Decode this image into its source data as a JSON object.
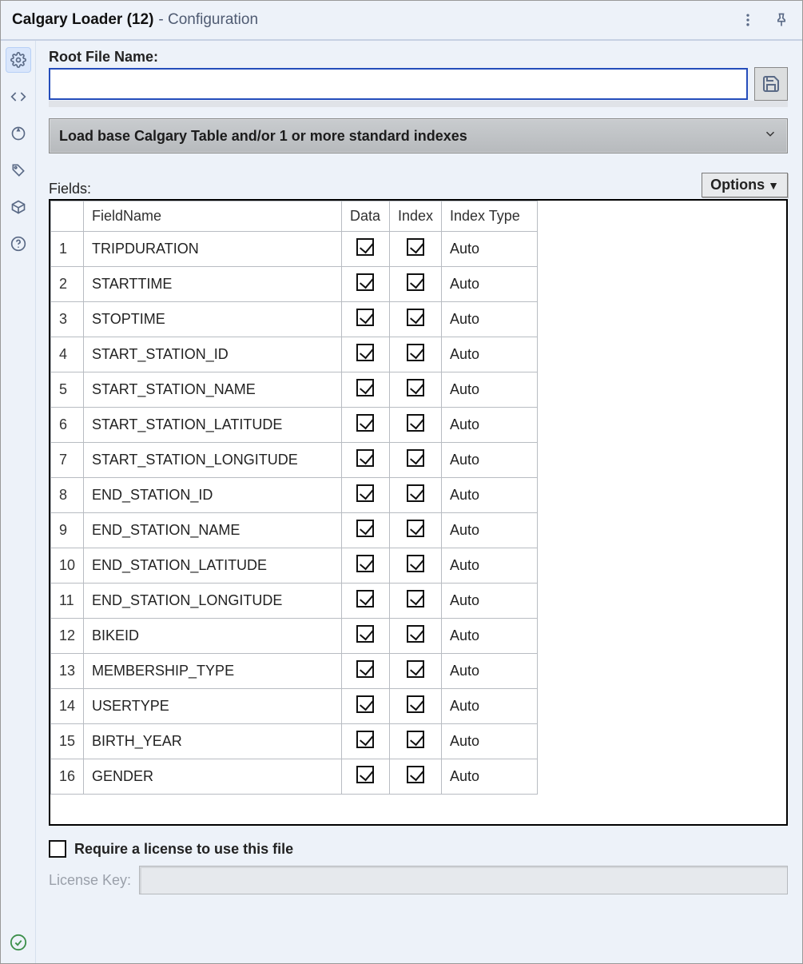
{
  "title": {
    "name": "Calgary Loader (12)",
    "sub": "- Configuration"
  },
  "root_file": {
    "label": "Root File Name:",
    "value": ""
  },
  "mode_select": {
    "text": "Load base Calgary Table and/or 1 or more standard indexes"
  },
  "fields": {
    "label": "Fields:",
    "options_btn": "Options",
    "columns": {
      "rownum": "",
      "name": "FieldName",
      "data": "Data",
      "index": "Index",
      "itype": "Index Type"
    },
    "rows": [
      {
        "n": "1",
        "name": "TRIPDURATION",
        "data": true,
        "index": true,
        "itype": "Auto"
      },
      {
        "n": "2",
        "name": "STARTTIME",
        "data": true,
        "index": true,
        "itype": "Auto"
      },
      {
        "n": "3",
        "name": "STOPTIME",
        "data": true,
        "index": true,
        "itype": "Auto"
      },
      {
        "n": "4",
        "name": "START_STATION_ID",
        "data": true,
        "index": true,
        "itype": "Auto"
      },
      {
        "n": "5",
        "name": "START_STATION_NAME",
        "data": true,
        "index": true,
        "itype": "Auto"
      },
      {
        "n": "6",
        "name": "START_STATION_LATITUDE",
        "data": true,
        "index": true,
        "itype": "Auto"
      },
      {
        "n": "7",
        "name": "START_STATION_LONGITUDE",
        "data": true,
        "index": true,
        "itype": "Auto"
      },
      {
        "n": "8",
        "name": "END_STATION_ID",
        "data": true,
        "index": true,
        "itype": "Auto"
      },
      {
        "n": "9",
        "name": "END_STATION_NAME",
        "data": true,
        "index": true,
        "itype": "Auto"
      },
      {
        "n": "10",
        "name": "END_STATION_LATITUDE",
        "data": true,
        "index": true,
        "itype": "Auto"
      },
      {
        "n": "11",
        "name": "END_STATION_LONGITUDE",
        "data": true,
        "index": true,
        "itype": "Auto"
      },
      {
        "n": "12",
        "name": "BIKEID",
        "data": true,
        "index": true,
        "itype": "Auto"
      },
      {
        "n": "13",
        "name": "MEMBERSHIP_TYPE",
        "data": true,
        "index": true,
        "itype": "Auto"
      },
      {
        "n": "14",
        "name": "USERTYPE",
        "data": true,
        "index": true,
        "itype": "Auto"
      },
      {
        "n": "15",
        "name": "BIRTH_YEAR",
        "data": true,
        "index": true,
        "itype": "Auto"
      },
      {
        "n": "16",
        "name": "GENDER",
        "data": true,
        "index": true,
        "itype": "Auto"
      }
    ]
  },
  "license": {
    "require_label": "Require a license to use this file",
    "require_checked": false,
    "key_label": "License Key:",
    "key_value": ""
  }
}
